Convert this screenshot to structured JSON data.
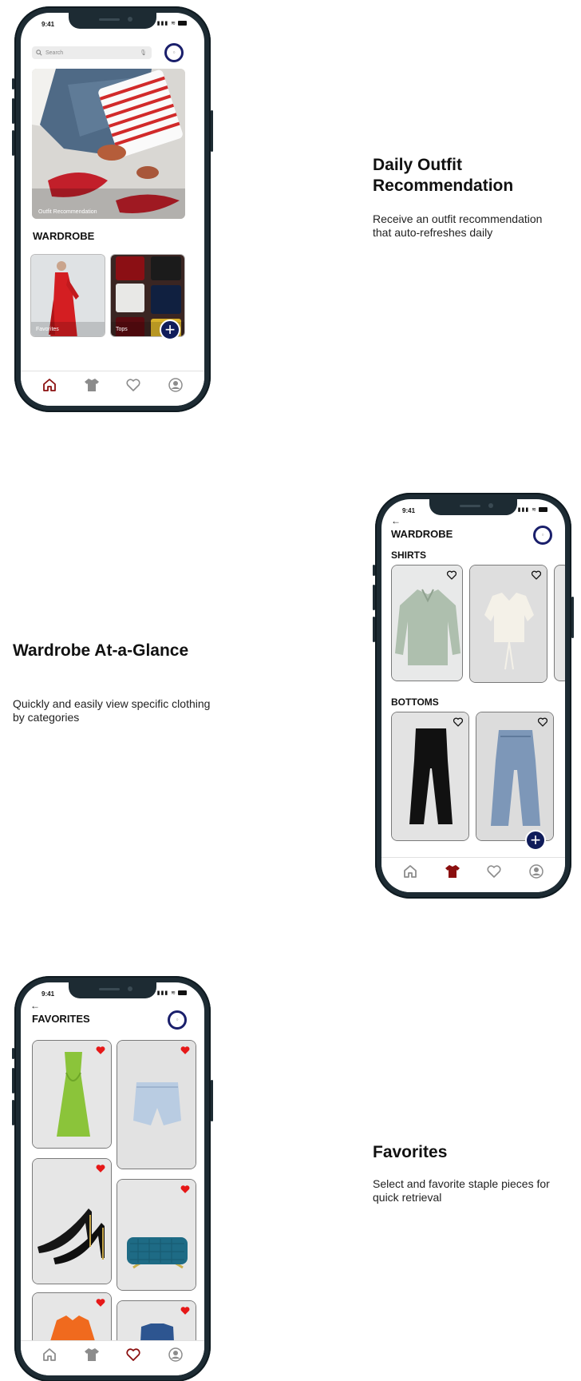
{
  "status_time": "9:41",
  "features": [
    {
      "title": "Daily Outfit Recommendation",
      "desc": "Receive an outfit recommendation that auto-refreshes daily"
    },
    {
      "title": "Wardrobe At-a-Glance",
      "desc": "Quickly and easily view specific clothing by categories"
    },
    {
      "title": "Favorites",
      "desc": "Select and favorite staple pieces for quick retrieval"
    }
  ],
  "home": {
    "search_placeholder": "Search",
    "hero_label": "Outfit Recommendation",
    "wardrobe_title": "WARDROBE",
    "cards": [
      {
        "label": "Favorites"
      },
      {
        "label": "Tops"
      }
    ]
  },
  "wardrobe": {
    "title": "WARDROBE",
    "shirts_title": "SHIRTS",
    "bottoms_title": "BOTTOMS"
  },
  "favorites": {
    "title": "FAVORITES"
  },
  "icons": {
    "home": "home-icon",
    "shirt": "shirt-icon",
    "heart": "heart-icon",
    "profile": "profile-icon",
    "plus": "plus-icon",
    "back": "back-arrow-icon",
    "search": "search-icon",
    "mic": "mic-icon"
  },
  "colors": {
    "accent": "#8b0f0f",
    "fab": "#101c5a",
    "avatar_ring": "#1a1f6b",
    "heart_active": "#e61818"
  }
}
